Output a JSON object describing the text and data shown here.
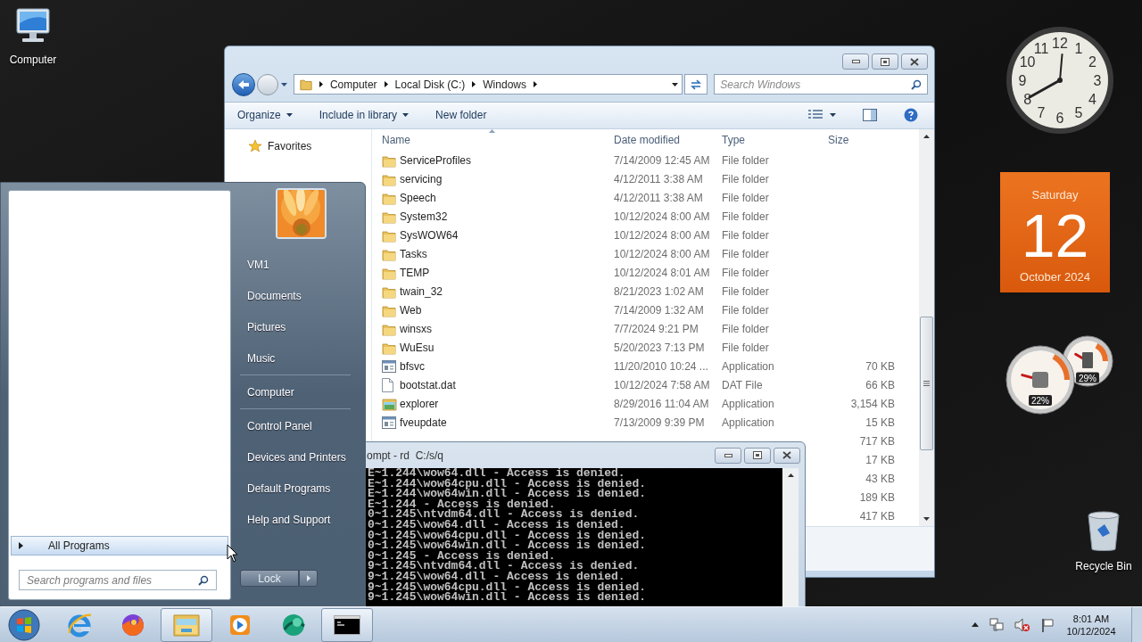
{
  "desktop_icons": [
    {
      "kind": "computer",
      "label": "Computer"
    },
    {
      "kind": "recycle_bin",
      "label": "Recycle Bin"
    }
  ],
  "explorer": {
    "breadcrumb": [
      "Computer",
      "Local Disk (C:)",
      "Windows"
    ],
    "search": {
      "placeholder": "Search Windows"
    },
    "toolbar": [
      {
        "label": "Organize",
        "dropdown": true
      },
      {
        "label": "Include in library",
        "dropdown": true
      },
      {
        "label": "New folder",
        "dropdown": false
      }
    ],
    "nav": [
      {
        "label": "Favorites"
      }
    ],
    "columns": [
      "Name",
      "Date modified",
      "Type",
      "Size"
    ],
    "rows": [
      {
        "kind": "folder",
        "name": "ServiceProfiles",
        "date": "7/14/2009 12:45 AM",
        "type": "File folder"
      },
      {
        "kind": "folder",
        "name": "servicing",
        "date": "4/12/2011 3:38 AM",
        "type": "File folder"
      },
      {
        "kind": "folder",
        "name": "Speech",
        "date": "4/12/2011 3:38 AM",
        "type": "File folder"
      },
      {
        "kind": "folder",
        "name": "System32",
        "date": "10/12/2024 8:00 AM",
        "type": "File folder"
      },
      {
        "kind": "folder",
        "name": "SysWOW64",
        "date": "10/12/2024 8:00 AM",
        "type": "File folder"
      },
      {
        "kind": "folder",
        "name": "Tasks",
        "date": "10/12/2024 8:00 AM",
        "type": "File folder"
      },
      {
        "kind": "folder",
        "name": "TEMP",
        "date": "10/12/2024 8:01 AM",
        "type": "File folder"
      },
      {
        "kind": "folder",
        "name": "twain_32",
        "date": "8/21/2023 1:02 AM",
        "type": "File folder"
      },
      {
        "kind": "folder",
        "name": "Web",
        "date": "7/14/2009 1:32 AM",
        "type": "File folder"
      },
      {
        "kind": "folder",
        "name": "winsxs",
        "date": "7/7/2024 9:21 PM",
        "type": "File folder"
      },
      {
        "kind": "folder",
        "name": "WuEsu",
        "date": "5/20/2023 7:13 PM",
        "type": "File folder"
      },
      {
        "kind": "app",
        "name": "bfsvc",
        "date": "11/20/2010 10:24 ...",
        "type": "Application",
        "size": "70 KB"
      },
      {
        "kind": "file",
        "name": "bootstat.dat",
        "date": "10/12/2024 7:58 AM",
        "type": "DAT File",
        "size": "66 KB"
      },
      {
        "kind": "explorer",
        "name": "explorer",
        "date": "8/29/2016 11:04 AM",
        "type": "Application",
        "size": "3,154 KB"
      },
      {
        "kind": "app",
        "name": "fveupdate",
        "date": "7/13/2009 9:39 PM",
        "type": "Application",
        "size": "15 KB"
      },
      {
        "size": "717 KB"
      },
      {
        "size": "17 KB"
      },
      {
        "size": "43 KB"
      },
      {
        "size": "189 KB"
      },
      {
        "size": "417 KB"
      }
    ]
  },
  "cmd": {
    "title": "ompt - rd  C:/s/q",
    "lines": [
      "E~1.244\\wow64.dll - Access is denied.",
      "E~1.244\\wow64cpu.dll - Access is denied.",
      "E~1.244\\wow64win.dll - Access is denied.",
      "E~1.244 - Access is denied.",
      "0~1.245\\ntvdm64.dll - Access is denied.",
      "0~1.245\\wow64.dll - Access is denied.",
      "0~1.245\\wow64cpu.dll - Access is denied.",
      "0~1.245\\wow64win.dll - Access is denied.",
      "0~1.245 - Access is denied.",
      "9~1.245\\ntvdm64.dll - Access is denied.",
      "9~1.245\\wow64.dll - Access is denied.",
      "9~1.245\\wow64cpu.dll - Access is denied.",
      "9~1.245\\wow64win.dll - Access is denied."
    ]
  },
  "start_menu": {
    "link_groups": [
      [
        "VM1",
        "Documents",
        "Pictures",
        "Music"
      ],
      [
        "Computer"
      ],
      [
        "Control Panel",
        "Devices and Printers",
        "Default Programs",
        "Help and Support"
      ]
    ],
    "all_programs": "All Programs",
    "search": {
      "placeholder": "Search programs and files"
    },
    "power_button": "Lock"
  },
  "gadgets": {
    "clock": {
      "numerals": [
        "12",
        "11",
        "1",
        "10",
        "2",
        "9",
        "3",
        "8",
        "4",
        "7",
        "5",
        "6"
      ]
    },
    "calendar": {
      "weekday": "Saturday",
      "day": "12",
      "month_year": "October 2024"
    },
    "meters": [
      {
        "kind": "cpu",
        "reading": "22%"
      },
      {
        "kind": "memory",
        "reading": "29%"
      }
    ]
  },
  "taskbar": {
    "apps": [
      {
        "kind": "ie",
        "selected": false
      },
      {
        "kind": "firefox",
        "selected": false
      },
      {
        "kind": "explorer",
        "selected": true
      },
      {
        "kind": "media",
        "selected": false
      },
      {
        "kind": "globe",
        "selected": false
      },
      {
        "kind": "cmd",
        "selected": true
      }
    ],
    "time": "8:01 AM",
    "date": "10/12/2024"
  }
}
